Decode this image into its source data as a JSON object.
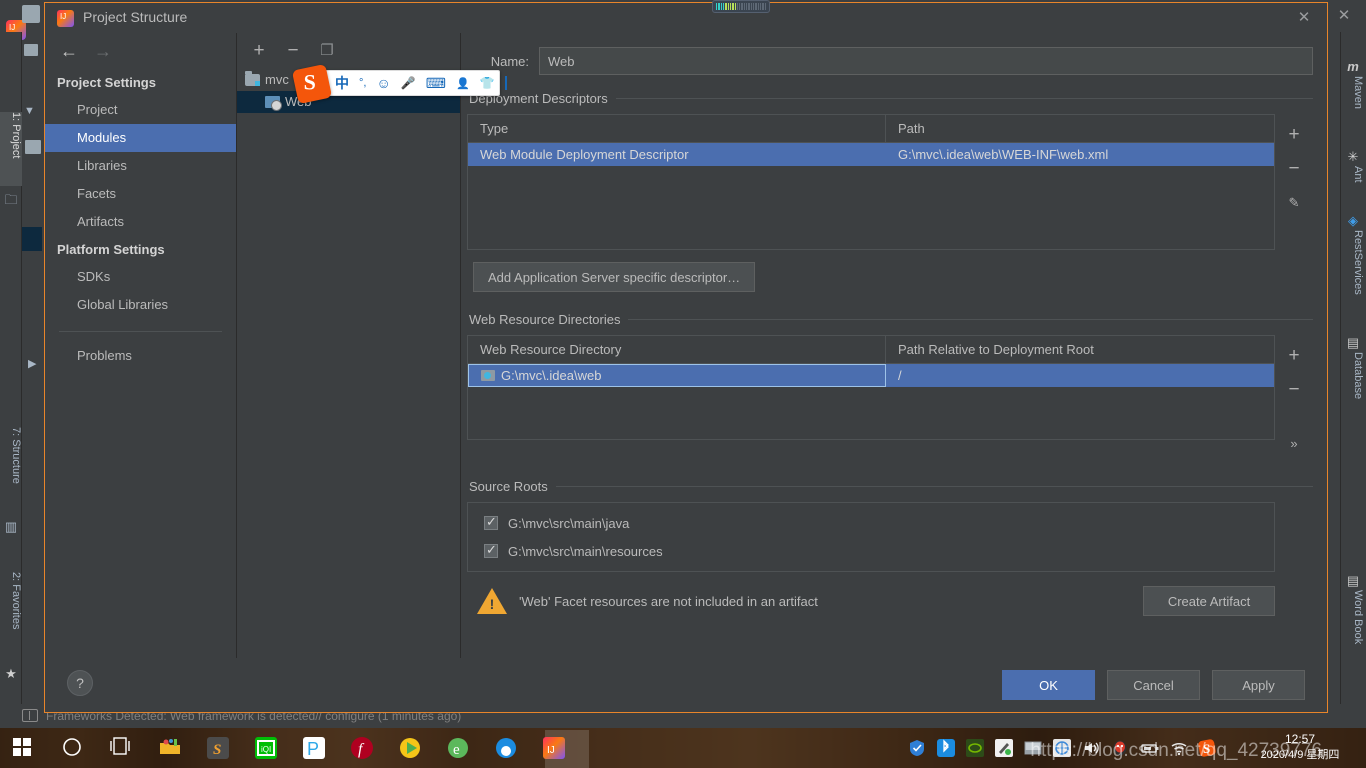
{
  "ide": {
    "close_label": "✕",
    "left_strip": [
      {
        "label": "1: Project",
        "icon": "folder-icon",
        "active": true
      },
      {
        "label": "7: Structure",
        "icon": "structure-icon",
        "active": false
      },
      {
        "label": "2: Favorites",
        "icon": "star-icon",
        "active": false
      }
    ],
    "right_strip": [
      {
        "label": "Maven",
        "icon": "maven-icon"
      },
      {
        "label": "Ant",
        "icon": "ant-icon"
      },
      {
        "label": "RestServices",
        "icon": "rest-services-icon"
      },
      {
        "label": "Database",
        "icon": "database-icon"
      },
      {
        "label": "Word Book",
        "icon": "word-book-icon"
      }
    ],
    "statusbar": "Frameworks Detected: Web framework is detected// configure (1 minutes ago)"
  },
  "dialog": {
    "title": "Project Structure",
    "close_label": "✕",
    "nav": {
      "back_icon": "←",
      "forward_icon": "→",
      "groups": [
        {
          "title": "Project Settings",
          "items": [
            {
              "label": "Project",
              "selected": false
            },
            {
              "label": "Modules",
              "selected": true
            },
            {
              "label": "Libraries",
              "selected": false
            },
            {
              "label": "Facets",
              "selected": false
            },
            {
              "label": "Artifacts",
              "selected": false
            }
          ]
        },
        {
          "title": "Platform Settings",
          "items": [
            {
              "label": "SDKs",
              "selected": false
            },
            {
              "label": "Global Libraries",
              "selected": false
            }
          ]
        }
      ],
      "problems_label": "Problems"
    },
    "tree": {
      "toolbar": [
        {
          "name": "add-module-button",
          "glyph": "+"
        },
        {
          "name": "remove-module-button",
          "glyph": "−"
        },
        {
          "name": "copy-module-button",
          "glyph": "❐"
        }
      ],
      "nodes": [
        {
          "label": "mvc",
          "icon": "module-folder-icon",
          "selected": false,
          "indent": 8
        },
        {
          "label": "Web",
          "icon": "web-facet-icon",
          "selected": true,
          "indent": 28
        }
      ]
    },
    "content": {
      "name_label": "Name:",
      "name_value": "Web",
      "deployment_descriptors": {
        "caption": "Deployment Descriptors",
        "columns": [
          "Type",
          "Path"
        ],
        "rows": [
          {
            "type": "Web Module Deployment Descriptor",
            "path": "G:\\mvc\\.idea\\web\\WEB-INF\\web.xml",
            "selected": true
          }
        ],
        "side_buttons": [
          {
            "name": "add-descriptor-button",
            "glyph": "+"
          },
          {
            "name": "remove-descriptor-button",
            "glyph": "−"
          },
          {
            "name": "edit-descriptor-button",
            "glyph": "✎"
          }
        ],
        "add_app_server_button": "Add Application Server specific descriptor…"
      },
      "web_resource_directories": {
        "caption": "Web Resource Directories",
        "columns": [
          "Web Resource Directory",
          "Path Relative to Deployment Root"
        ],
        "rows": [
          {
            "directory": "G:\\mvc\\.idea\\web",
            "relative_path": "/",
            "selected": true,
            "editing": true
          }
        ],
        "side_buttons": [
          {
            "name": "add-web-resource-button",
            "glyph": "+"
          },
          {
            "name": "remove-web-resource-button",
            "glyph": "−"
          },
          {
            "name": "expand-web-resource-button",
            "glyph": "»"
          }
        ]
      },
      "source_roots": {
        "caption": "Source Roots",
        "items": [
          {
            "label": "G:\\mvc\\src\\main\\java",
            "checked": true
          },
          {
            "label": "G:\\mvc\\src\\main\\resources",
            "checked": true
          }
        ]
      },
      "warning": {
        "text": "'Web' Facet resources are not included in an artifact",
        "action_label": "Create Artifact",
        "icon": "warning-triangle-icon",
        "color": "#f0a732"
      }
    },
    "footer": {
      "help_label": "?",
      "ok_label": "OK",
      "cancel_label": "Cancel",
      "apply_label": "Apply"
    }
  },
  "ime": {
    "logo": "sogou-logo-icon",
    "items": [
      {
        "name": "chinese-mode-icon",
        "glyph": "中"
      },
      {
        "name": "punctuation-icon",
        "glyph": "°,"
      },
      {
        "name": "emoji-icon",
        "glyph": "☺"
      },
      {
        "name": "voice-input-icon",
        "glyph": "🎤"
      },
      {
        "name": "soft-keyboard-icon",
        "glyph": "⌨"
      },
      {
        "name": "user-center-icon",
        "glyph": "👤"
      },
      {
        "name": "skin-icon",
        "glyph": "👕"
      },
      {
        "name": "toolbox-icon",
        "glyph": "▦"
      }
    ]
  },
  "taskbar": {
    "start_icon": "windows-start-icon",
    "items": [
      {
        "name": "cortana-icon",
        "color": "#ffffff"
      },
      {
        "name": "task-view-icon",
        "color": "#ffffff"
      },
      {
        "name": "explorer-icon",
        "color": "#ffc83d"
      },
      {
        "name": "sublime-text-icon",
        "color": "#4c4c4c"
      },
      {
        "name": "iqiyi-icon",
        "color": "#00be06"
      },
      {
        "name": "pdf-reader-icon",
        "color": "#2fa8e8"
      },
      {
        "name": "flash-icon",
        "color": "#b00020"
      },
      {
        "name": "potplayer-icon",
        "color": "#f0c419"
      },
      {
        "name": "ebook-icon",
        "color": "#4caf50"
      },
      {
        "name": "browser-icon",
        "color": "#1b8ce0"
      },
      {
        "name": "intellij-idea-icon",
        "color": "#7c53f7"
      }
    ],
    "tray": [
      {
        "name": "security-shield-icon",
        "color": "#2f7fd6"
      },
      {
        "name": "bluetooth-icon",
        "color": "#1b8ce0"
      },
      {
        "name": "nvidia-icon",
        "color": "#76b900"
      },
      {
        "name": "wacom-pen-icon",
        "color": "#cfd6da"
      },
      {
        "name": "touchpad-icon",
        "color": "#b9c0c4"
      },
      {
        "name": "network-monitor-icon",
        "color": "#3f8ad8"
      },
      {
        "name": "volume-icon",
        "color": "#eaeaea"
      },
      {
        "name": "qq-icon",
        "color": "#d93a2a"
      },
      {
        "name": "battery-icon",
        "color": "#d8d8d8"
      },
      {
        "name": "wifi-icon",
        "color": "#e8e8e8"
      },
      {
        "name": "sogou-tray-icon",
        "color": "#f4560b"
      }
    ],
    "clock_time": "12:57",
    "clock_date": "2020/4/9 星期四",
    "watermark": "https://blog.csdn.net/qq_42739776"
  },
  "gauge": {
    "name": "audio-level-meter",
    "segments_on": 9,
    "segments_total": 22
  }
}
